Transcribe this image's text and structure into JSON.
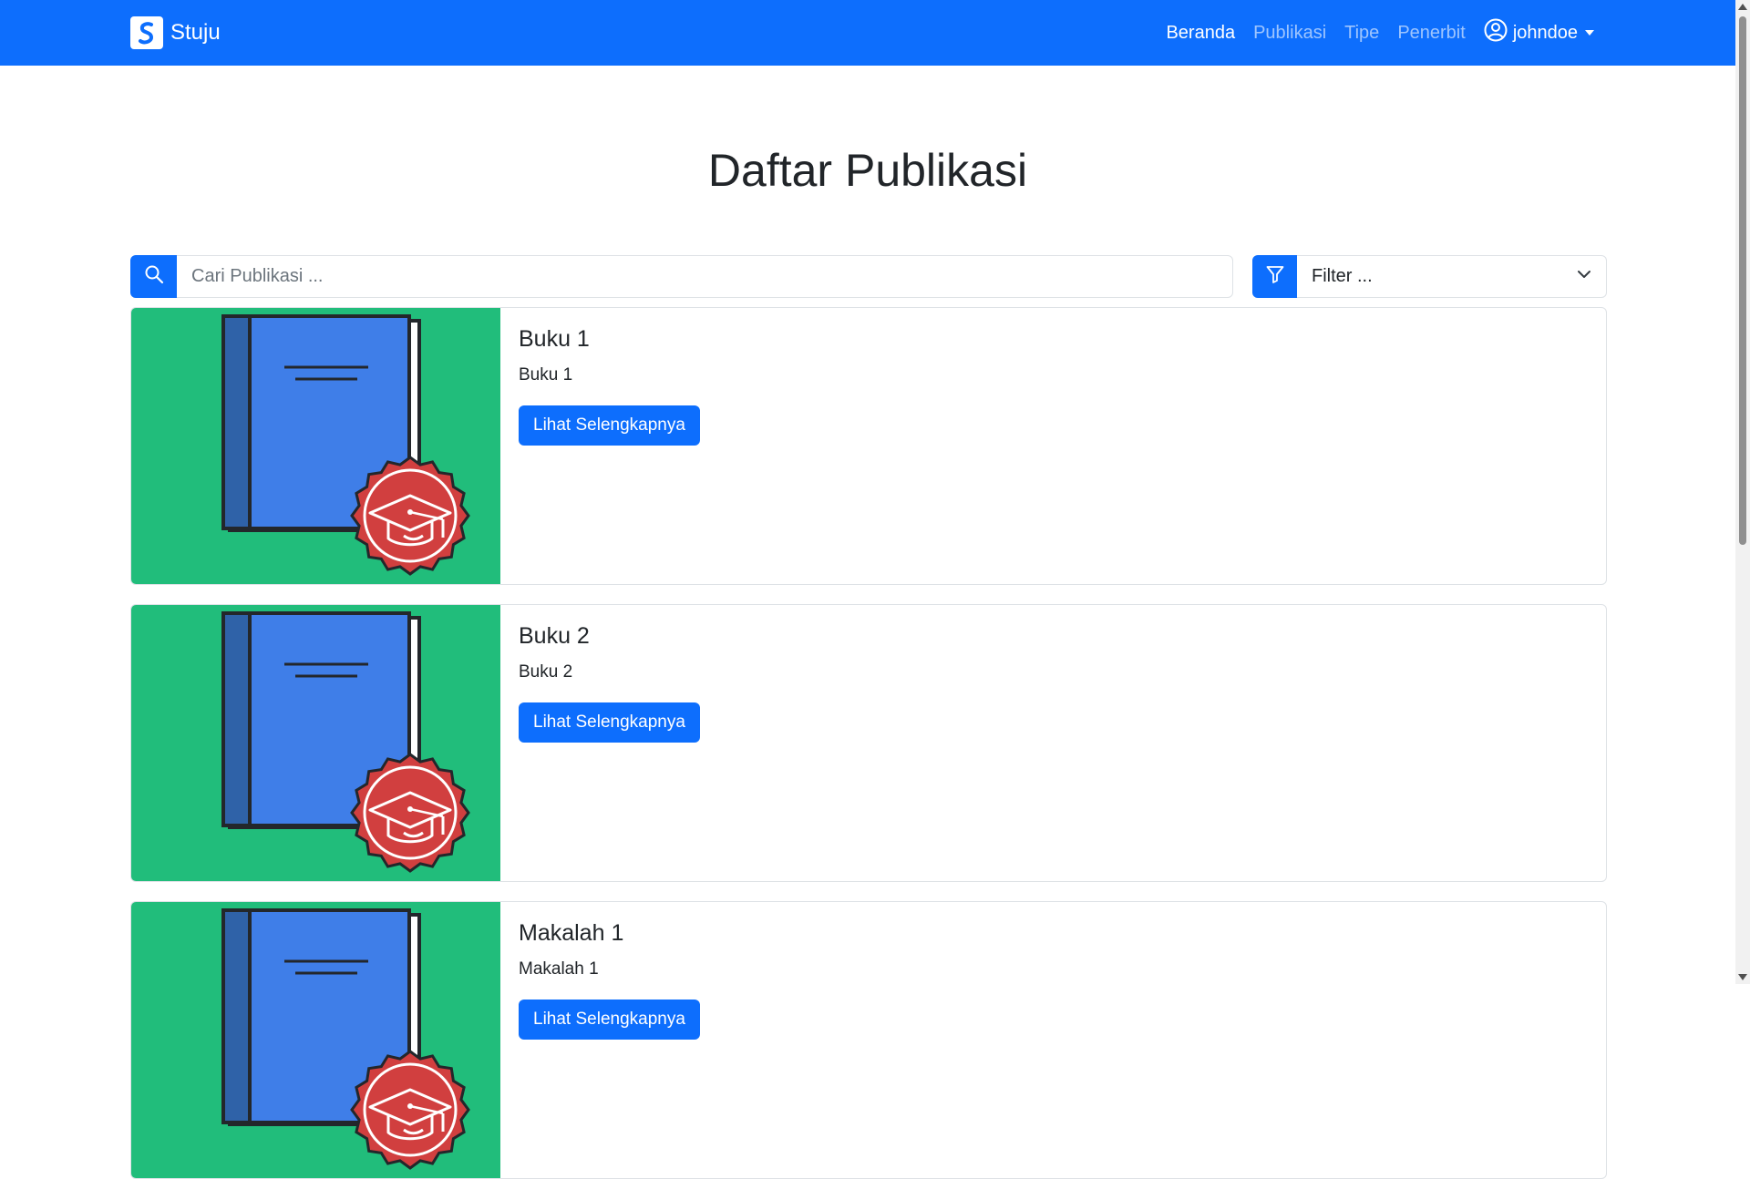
{
  "navbar": {
    "brand": "Stuju",
    "links": [
      {
        "label": "Beranda",
        "active": true
      },
      {
        "label": "Publikasi",
        "active": false
      },
      {
        "label": "Tipe",
        "active": false
      },
      {
        "label": "Penerbit",
        "active": false
      }
    ],
    "user": "johndoe"
  },
  "page": {
    "title": "Daftar Publikasi"
  },
  "search": {
    "placeholder": "Cari Publikasi ...",
    "value": ""
  },
  "filter": {
    "placeholder": "Filter ..."
  },
  "publications": [
    {
      "title": "Buku 1",
      "description": "Buku 1",
      "button_label": "Lihat Selengkapnya"
    },
    {
      "title": "Buku 2",
      "description": "Buku 2",
      "button_label": "Lihat Selengkapnya"
    },
    {
      "title": "Makalah 1",
      "description": "Makalah 1",
      "button_label": "Lihat Selengkapnya"
    }
  ],
  "colors": {
    "primary": "#0d6efd",
    "card_image_bg": "#21bd7b",
    "badge": "#d13f3f",
    "book_cover": "#3f7ee8",
    "book_spine": "#2f62a8"
  },
  "icons": {
    "brand": "brand-logo-icon",
    "user": "user-circle-icon",
    "search": "search-icon",
    "filter": "filter-icon",
    "dropdown": "chevron-down-icon",
    "card_image": "book-graduation-icon"
  }
}
